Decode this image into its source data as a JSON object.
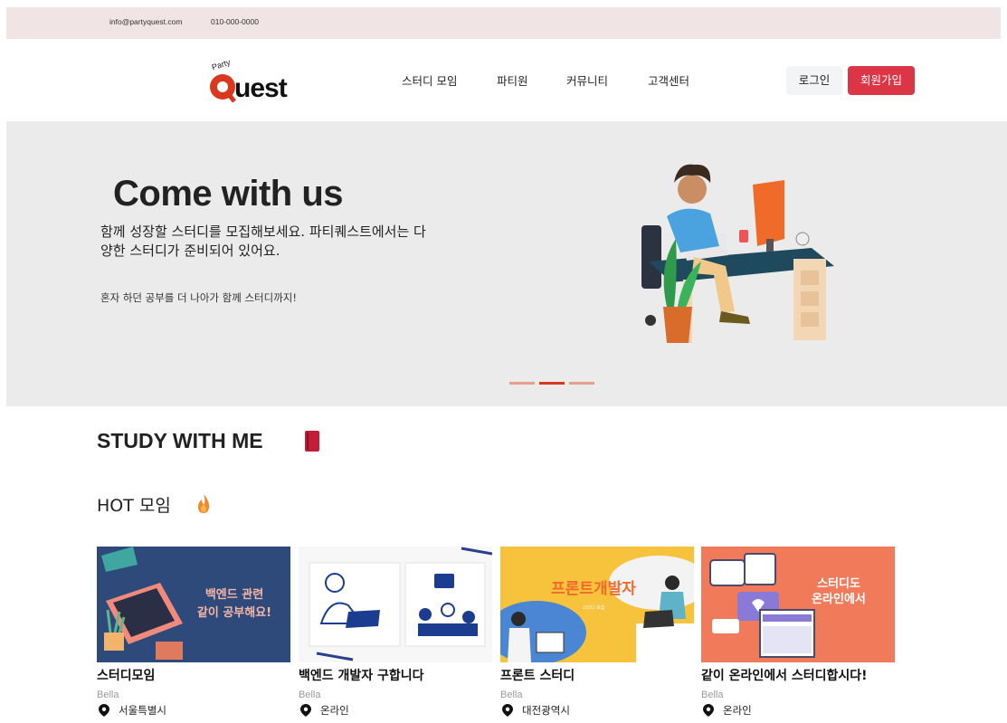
{
  "topbar": {
    "email": "info@partyquest.com",
    "phone": "010-000-0000"
  },
  "brand": {
    "logo_text": "Quest",
    "logo_small": "Party"
  },
  "nav": [
    {
      "label": "스터디 모임"
    },
    {
      "label": "파티원"
    },
    {
      "label": "커뮤니티"
    },
    {
      "label": "고객센터"
    }
  ],
  "auth": {
    "login": "로그인",
    "signup": "회원가입"
  },
  "hero": {
    "title": "Come with us",
    "subtitle": "함께 성장할 스터디를 모집해보세요. 파티퀘스트에서는 다양한 스터디가 준비되어 있어요.",
    "tagline": "혼자 하던 공부를 더 나아가 함께 스터디까지!",
    "active_slide": 2,
    "slide_count": 3
  },
  "section": {
    "title": "STUDY WITH ME",
    "hot_title": "HOT 모임"
  },
  "cards": [
    {
      "title": "스터디모임",
      "author": "Bella",
      "location": "서울특별시",
      "image_text": "백엔드 관련 같이 공부해요!"
    },
    {
      "title": "백엔드 개발자 구합니다",
      "author": "Bella",
      "location": "온라인"
    },
    {
      "title": "프론트 스터디",
      "author": "Bella",
      "location": "대전광역시",
      "image_text": "프론트개발자"
    },
    {
      "title": "같이 온라인에서 스터디합시다!",
      "author": "Bella",
      "location": "온라인",
      "image_text": "스터디도 온라인에서"
    }
  ],
  "colors": {
    "accent": "#dc3545",
    "topbar_bg": "#f0e4e4",
    "hero_bg": "#ebebeb"
  }
}
